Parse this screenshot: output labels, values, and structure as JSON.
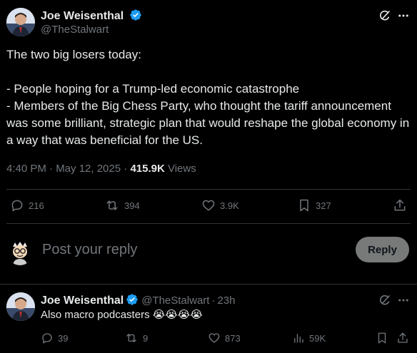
{
  "main_tweet": {
    "author_name": "Joe Weisenthal",
    "author_handle": "@TheStalwart",
    "lines": [
      "The two big losers today:",
      "",
      "- People hoping for a Trump-led economic catastrophe",
      "- Members of the Big Chess Party, who thought the tariff announcement was some brilliant, strategic plan that would reshape the global economy in a way that was beneficial for the US."
    ],
    "timestamp": "4:40 PM · May 12, 2025",
    "separator": " · ",
    "views_count": "415.9K",
    "views_label": " Views",
    "replies": "216",
    "reposts": "394",
    "likes": "3.9K",
    "bookmarks": "327"
  },
  "reply_box": {
    "placeholder": "Post your reply",
    "button_label": "Reply"
  },
  "reply_tweet": {
    "author_name": "Joe Weisenthal",
    "author_handle": "@TheStalwart",
    "time": "23h",
    "separator": "·",
    "text": "Also macro podcasters 😭😭😭😭",
    "replies": "39",
    "reposts": "9",
    "likes": "873",
    "views": "59K"
  },
  "colors": {
    "background": "#000000",
    "text": "#e7e9ea",
    "muted": "#71767b",
    "verified": "#1d9bf0",
    "divider": "#2f3336"
  },
  "icons": [
    "verified-badge-icon",
    "grok-icon",
    "more-icon",
    "reply-icon",
    "repost-icon",
    "like-icon",
    "bookmark-icon",
    "share-icon",
    "views-icon"
  ]
}
